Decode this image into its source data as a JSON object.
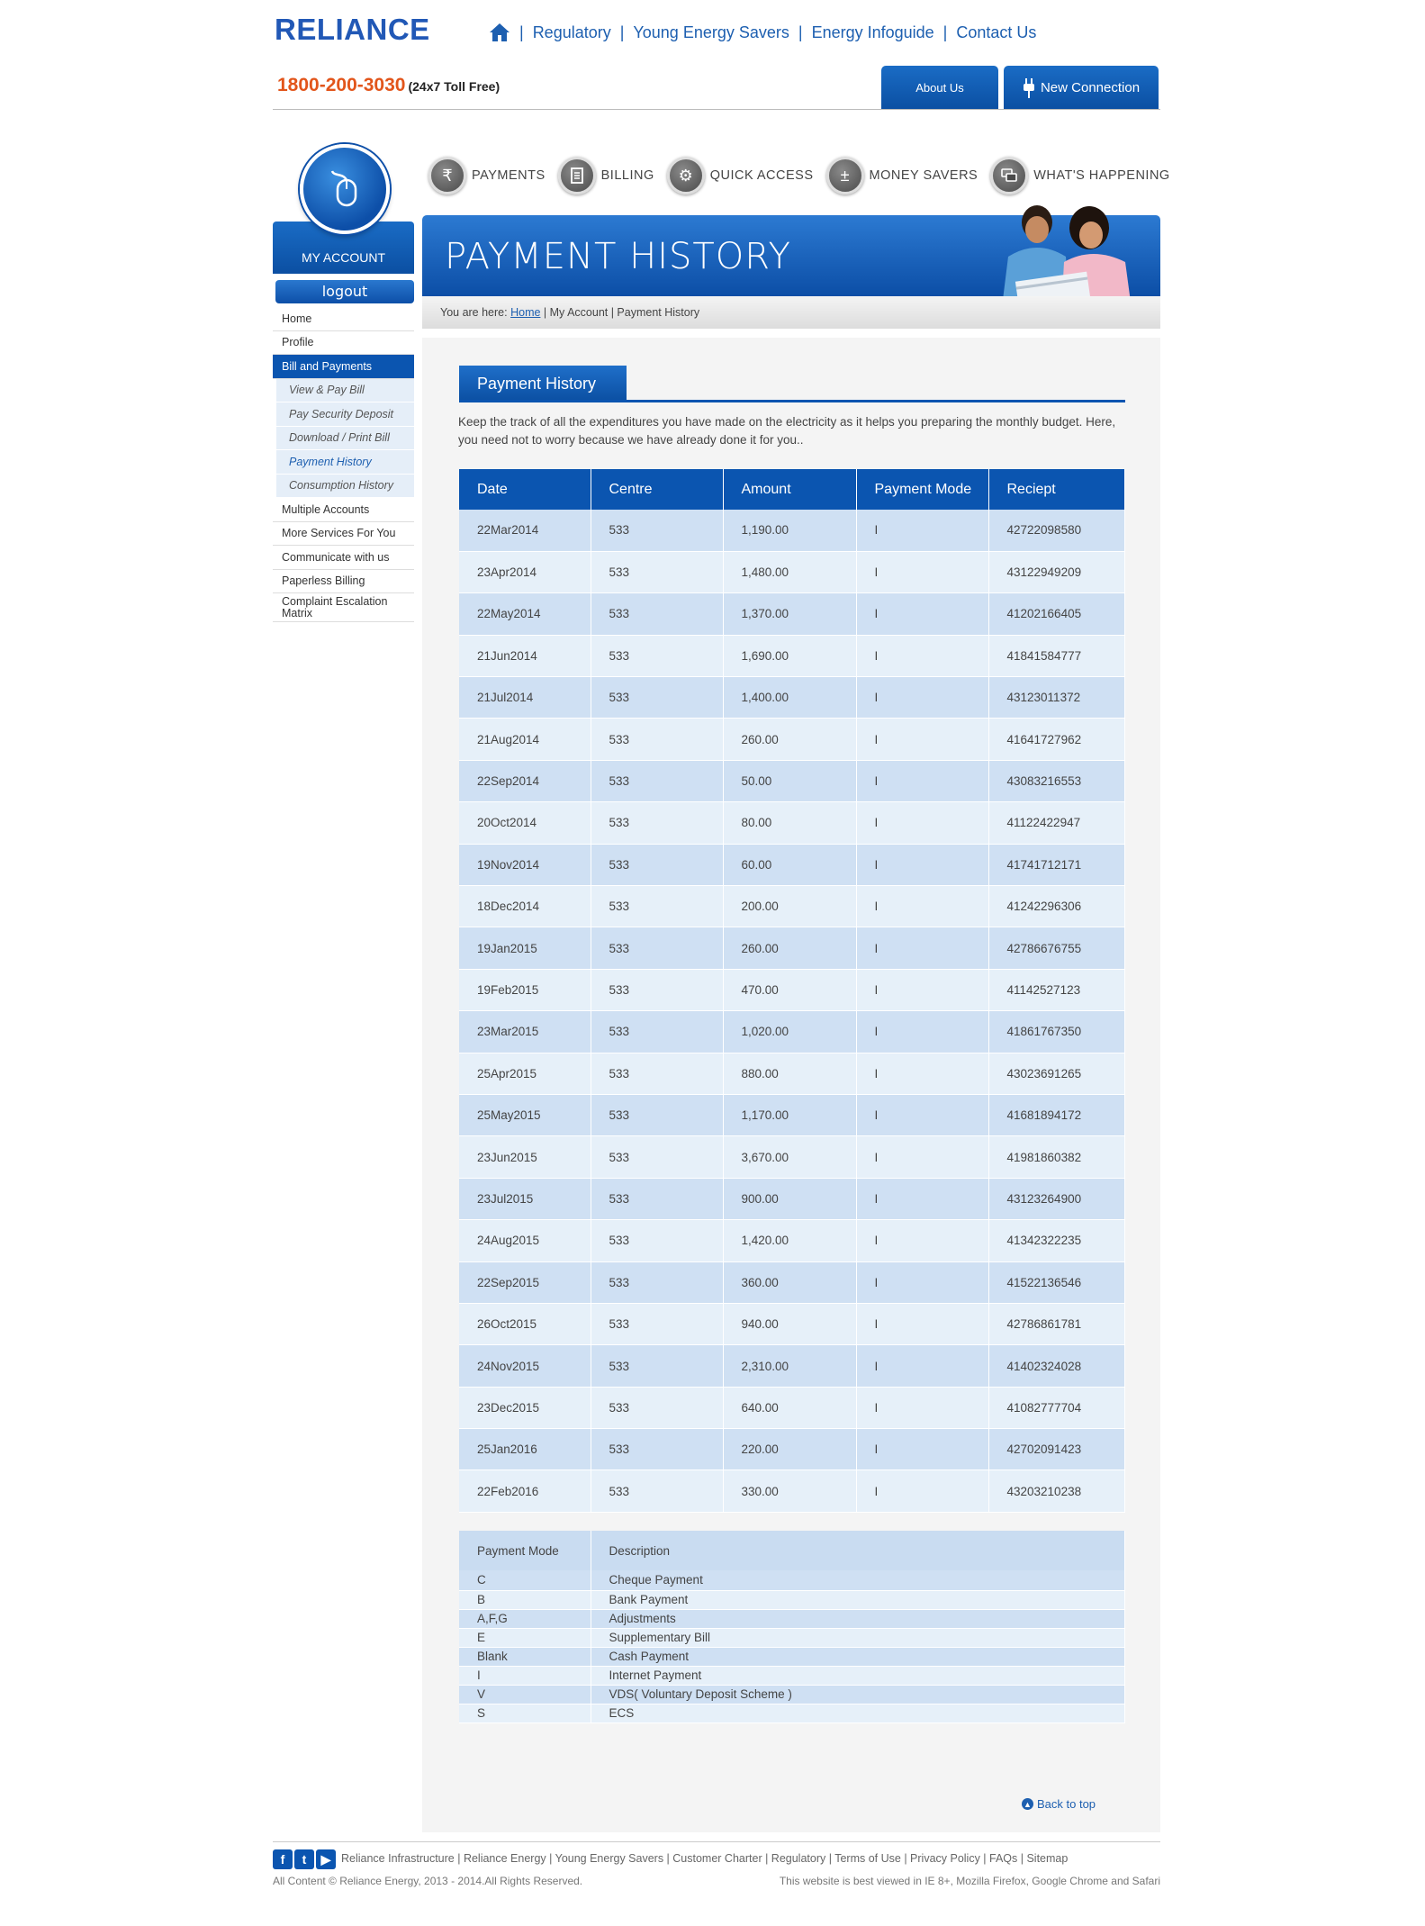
{
  "header": {
    "logo": "RELIANCE",
    "nav": [
      "Regulatory",
      "Young Energy Savers",
      "Energy Infoguide",
      "Contact Us"
    ],
    "phone": "1800-200-3030",
    "phone_note": "(24x7 Toll Free)",
    "about_label": "About Us",
    "new_connection_label": "New Connection"
  },
  "sidebar": {
    "my_account": "MY ACCOUNT",
    "logout": "logout",
    "items": [
      {
        "label": "Home"
      },
      {
        "label": "Profile"
      },
      {
        "label": "Bill and Payments"
      },
      {
        "label": "View & Pay Bill"
      },
      {
        "label": "Pay Security Deposit"
      },
      {
        "label": "Download / Print Bill"
      },
      {
        "label": "Payment History"
      },
      {
        "label": "Consumption History"
      },
      {
        "label": "Multiple Accounts"
      },
      {
        "label": "More Services For You"
      },
      {
        "label": "Communicate with us"
      },
      {
        "label": "Paperless Billing"
      },
      {
        "label": "Complaint Escalation Matrix"
      }
    ]
  },
  "iconnav": [
    "PAYMENTS",
    "BILLING",
    "QUICK ACCESS",
    "MONEY SAVERS",
    "WHAT'S HAPPENING"
  ],
  "banner": {
    "title": "PAYMENT HISTORY",
    "crumb_prefix": "You are here:",
    "crumb_home": "Home",
    "crumb_rest": " | My Account | Payment History"
  },
  "main": {
    "section_title": "Payment History",
    "intro": "Keep the track of all the expenditures you have made on the electricity as it helps you preparing the monthly budget. Here, you need not to worry because we have already done it for you..",
    "columns": [
      "Date",
      "Centre",
      "Amount",
      "Payment Mode",
      "Reciept"
    ],
    "rows": [
      [
        "22Mar2014",
        "533",
        "1,190.00",
        "I",
        "42722098580"
      ],
      [
        "23Apr2014",
        "533",
        "1,480.00",
        "I",
        "43122949209"
      ],
      [
        "22May2014",
        "533",
        "1,370.00",
        "I",
        "41202166405"
      ],
      [
        "21Jun2014",
        "533",
        "1,690.00",
        "I",
        "41841584777"
      ],
      [
        "21Jul2014",
        "533",
        "1,400.00",
        "I",
        "43123011372"
      ],
      [
        "21Aug2014",
        "533",
        "260.00",
        "I",
        "41641727962"
      ],
      [
        "22Sep2014",
        "533",
        "50.00",
        "I",
        "43083216553"
      ],
      [
        "20Oct2014",
        "533",
        "80.00",
        "I",
        "41122422947"
      ],
      [
        "19Nov2014",
        "533",
        "60.00",
        "I",
        "41741712171"
      ],
      [
        "18Dec2014",
        "533",
        "200.00",
        "I",
        "41242296306"
      ],
      [
        "19Jan2015",
        "533",
        "260.00",
        "I",
        "42786676755"
      ],
      [
        "19Feb2015",
        "533",
        "470.00",
        "I",
        "41142527123"
      ],
      [
        "23Mar2015",
        "533",
        "1,020.00",
        "I",
        "41861767350"
      ],
      [
        "25Apr2015",
        "533",
        "880.00",
        "I",
        "43023691265"
      ],
      [
        "25May2015",
        "533",
        "1,170.00",
        "I",
        "41681894172"
      ],
      [
        "23Jun2015",
        "533",
        "3,670.00",
        "I",
        "41981860382"
      ],
      [
        "23Jul2015",
        "533",
        "900.00",
        "I",
        "43123264900"
      ],
      [
        "24Aug2015",
        "533",
        "1,420.00",
        "I",
        "41342322235"
      ],
      [
        "22Sep2015",
        "533",
        "360.00",
        "I",
        "41522136546"
      ],
      [
        "26Oct2015",
        "533",
        "940.00",
        "I",
        "42786861781"
      ],
      [
        "24Nov2015",
        "533",
        "2,310.00",
        "I",
        "41402324028"
      ],
      [
        "23Dec2015",
        "533",
        "640.00",
        "I",
        "41082777704"
      ],
      [
        "25Jan2016",
        "533",
        "220.00",
        "I",
        "42702091423"
      ],
      [
        "22Feb2016",
        "533",
        "330.00",
        "I",
        "43203210238"
      ]
    ],
    "legend_columns": [
      "Payment Mode",
      "Description"
    ],
    "legend_rows": [
      [
        "C",
        "Cheque Payment"
      ],
      [
        "B",
        "Bank Payment"
      ],
      [
        "A,F,G",
        "Adjustments"
      ],
      [
        "E",
        "Supplementary Bill"
      ],
      [
        "Blank",
        "Cash Payment"
      ],
      [
        "I",
        "Internet Payment"
      ],
      [
        "V",
        "VDS( Voluntary Deposit Scheme )"
      ],
      [
        "S",
        "ECS"
      ]
    ],
    "back_to_top": "Back to top"
  },
  "footer": {
    "links": "Reliance Infrastructure | Reliance Energy | Young Energy Savers | Customer Charter | Regulatory | Terms of Use | Privacy Policy | FAQs | Sitemap",
    "copyright": "All Content © Reliance Energy, 2013 - 2014.All Rights Reserved.",
    "browser_note": "This website is best viewed in IE 8+, Mozilla Firefox, Google Chrome and Safari"
  },
  "colors": {
    "brand_blue": "#0b55b0",
    "accent_orange": "#e2551b"
  }
}
